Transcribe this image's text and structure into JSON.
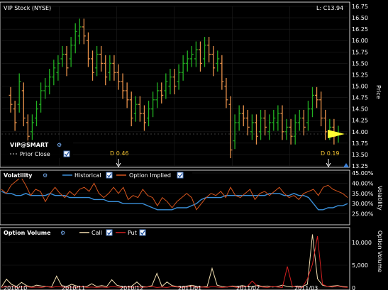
{
  "price_panel": {
    "symbol_title": "VIP Stock (NYSE)",
    "last_label": "L: C13.94",
    "axis_title": "Price",
    "legend_symbol": "VIP@SMART",
    "legend_prior_close": "Prior Close",
    "dividend_1": "D 0.46",
    "dividend_2": "D 0.19"
  },
  "volatility_panel": {
    "title": "Volatility",
    "series_historical": "Historical",
    "series_implied": "Option Implied",
    "axis_title": "Volatility"
  },
  "volume_panel": {
    "title": "Option Volume",
    "series_call": "Call",
    "series_put": "Put",
    "axis_title": "Option Volume"
  },
  "x_axis_labels": [
    "2010/10",
    "2010/11",
    "2010/12",
    "2011/01",
    "2011/02",
    "2011/03"
  ],
  "colors": {
    "up": "#22b022",
    "down": "#e8914a",
    "historical": "#3a8fd8",
    "implied": "#d9561e",
    "call": "#f2deb0",
    "put": "#d42020",
    "dividend": "#f2c230",
    "prior_close": "#ffff33"
  },
  "chart_data": [
    {
      "type": "bar",
      "name": "price",
      "ylabel": "Price",
      "ylim": [
        13.25,
        16.75
      ],
      "yticks": [
        13.25,
        13.5,
        13.75,
        14.0,
        14.25,
        14.5,
        14.75,
        15.0,
        15.25,
        15.5,
        15.75,
        16.0,
        16.25,
        16.5,
        16.75
      ],
      "ytick_labels": [
        "13.25",
        "13.50",
        "13.75",
        "14.00",
        "14.25",
        "14.50",
        "14.75",
        "15.00",
        "15.25",
        "15.50",
        "15.75",
        "16.00",
        "16.25",
        "16.50",
        "16.75"
      ],
      "x_labels": [
        "2010/10",
        "2010/11",
        "2010/12",
        "2011/01",
        "2011/02",
        "2011/03"
      ],
      "dividends": [
        {
          "label": "D 0.46",
          "position": 0.33
        },
        {
          "label": "D 0.19",
          "position": 0.94
        }
      ],
      "closes": [
        14.6,
        14.2,
        15.1,
        14.3,
        13.9,
        14.2,
        14.5,
        14.9,
        15.0,
        15.2,
        15.4,
        15.5,
        15.7,
        15.4,
        15.9,
        16.2,
        16.3,
        16.1,
        15.6,
        15.3,
        15.7,
        15.5,
        15.2,
        15.5,
        15.3,
        15.1,
        14.9,
        14.7,
        14.3,
        14.6,
        14.4,
        14.2,
        14.5,
        14.7,
        14.9,
        14.8,
        15.1,
        15.2,
        15.0,
        15.3,
        15.5,
        15.6,
        15.7,
        15.8,
        15.5,
        15.9,
        15.7,
        15.4,
        15.6,
        15.1,
        14.7,
        13.6,
        14.2,
        14.4,
        14.3,
        14.1,
        14.2,
        13.9,
        14.3,
        14.1,
        14.2,
        14.3,
        14.4,
        14.0,
        14.1,
        13.9,
        14.2,
        14.3,
        14.1,
        14.5,
        14.8,
        14.7,
        14.3,
        14.0,
        14.1,
        13.9,
        13.95
      ],
      "opens": [
        14.8,
        14.5,
        14.6,
        14.9,
        14.2,
        14.0,
        14.3,
        14.6,
        14.9,
        15.0,
        15.2,
        15.3,
        15.6,
        15.7,
        15.6,
        15.9,
        16.1,
        16.3,
        16.0,
        15.6,
        15.4,
        15.7,
        15.5,
        15.3,
        15.5,
        15.3,
        15.1,
        14.9,
        14.7,
        14.4,
        14.6,
        14.4,
        14.3,
        14.5,
        14.7,
        14.9,
        14.9,
        15.0,
        15.2,
        15.1,
        15.3,
        15.5,
        15.6,
        15.6,
        15.8,
        15.6,
        15.9,
        15.7,
        15.5,
        15.5,
        15.0,
        14.6,
        13.8,
        14.2,
        14.4,
        14.3,
        14.0,
        14.2,
        14.0,
        14.3,
        14.0,
        14.2,
        14.2,
        14.4,
        14.0,
        14.1,
        13.9,
        14.2,
        14.3,
        14.2,
        14.5,
        14.8,
        14.7,
        14.3,
        14.0,
        14.1,
        13.94
      ]
    },
    {
      "type": "line",
      "name": "volatility",
      "ylabel": "Volatility",
      "ylim": [
        20,
        45
      ],
      "yticks": [
        25,
        30,
        35,
        40,
        45
      ],
      "ytick_labels": [
        "25.00%",
        "30.00%",
        "35.00%",
        "40.00%",
        "45.00%"
      ],
      "series": [
        {
          "name": "Historical",
          "values": [
            36,
            35,
            35,
            34,
            34,
            35,
            34,
            34,
            34,
            34,
            35,
            34,
            34,
            34,
            33,
            33,
            33,
            33,
            33,
            32,
            32,
            32,
            31,
            31,
            31,
            30,
            30,
            30,
            30,
            30,
            29,
            28,
            27,
            27,
            27,
            27,
            28,
            28,
            28,
            29,
            30,
            32,
            33,
            33,
            33,
            33,
            34,
            34,
            34,
            34,
            34,
            34,
            34,
            34,
            34,
            35,
            35,
            35,
            34,
            34,
            35,
            34,
            34,
            33,
            30,
            27,
            27,
            28,
            28,
            29,
            29,
            30
          ]
        },
        {
          "name": "Option Implied",
          "values": [
            37,
            35,
            39,
            41,
            43,
            39,
            34,
            37,
            36,
            31,
            35,
            38,
            35,
            33,
            36,
            34,
            37,
            38,
            36,
            40,
            35,
            33,
            35,
            38,
            35,
            38,
            32,
            34,
            33,
            37,
            34,
            33,
            29,
            33,
            31,
            28,
            31,
            33,
            35,
            33,
            27,
            30,
            33,
            35,
            34,
            36,
            33,
            38,
            34,
            33,
            35,
            37,
            32,
            35,
            36,
            34,
            36,
            38,
            35,
            33,
            34,
            32,
            35,
            36,
            37,
            34,
            38,
            39,
            37,
            36,
            35,
            33
          ]
        }
      ]
    },
    {
      "type": "bar",
      "name": "option_volume",
      "ylabel": "Option Volume",
      "ylim": [
        0,
        12500
      ],
      "yticks": [
        0,
        5000,
        10000
      ],
      "ytick_labels": [
        "0",
        "5,000",
        "10,000"
      ],
      "series": [
        {
          "name": "Call",
          "values": [
            200,
            1900,
            800,
            300,
            1200,
            500,
            200,
            600,
            400,
            300,
            200,
            2600,
            500,
            300,
            800,
            400,
            200,
            300,
            900,
            300,
            500,
            300,
            1800,
            600,
            300,
            200,
            400,
            1300,
            300,
            200,
            500,
            3200,
            300,
            1300,
            500,
            300,
            200,
            400,
            600,
            300,
            200,
            300,
            4300,
            600,
            300,
            200,
            400,
            300,
            500,
            300,
            200,
            600,
            300,
            400,
            200,
            300,
            600,
            300,
            200,
            400,
            300,
            800,
            11800,
            2000,
            600,
            300,
            400,
            500,
            300,
            200
          ]
        },
        {
          "name": "Put",
          "values": [
            100,
            300,
            400,
            100,
            200,
            300,
            100,
            200,
            100,
            300,
            100,
            300,
            200,
            100,
            200,
            100,
            300,
            100,
            200,
            100,
            200,
            100,
            300,
            200,
            100,
            200,
            100,
            300,
            100,
            200,
            300,
            100,
            200,
            100,
            300,
            200,
            100,
            200,
            300,
            100,
            200,
            100,
            300,
            200,
            100,
            200,
            300,
            100,
            200,
            300,
            1500,
            400,
            200,
            100,
            300,
            200,
            100,
            4700,
            300,
            200,
            100,
            2000,
            5200,
            11400,
            800,
            300,
            200,
            400,
            200,
            100
          ]
        }
      ]
    }
  ]
}
